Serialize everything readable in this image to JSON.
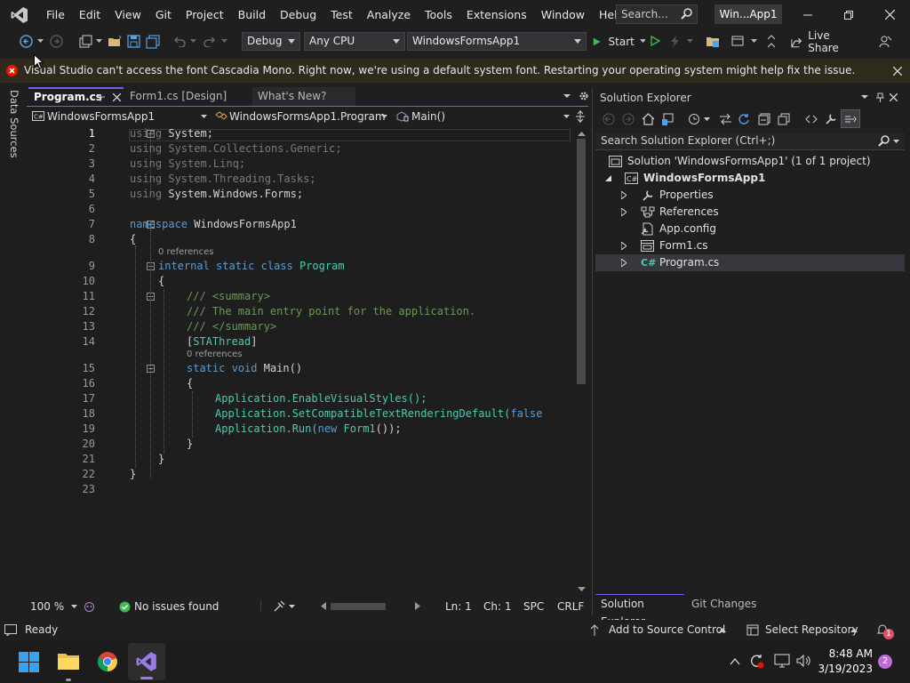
{
  "menu": {
    "items": [
      "File",
      "Edit",
      "View",
      "Git",
      "Project",
      "Build",
      "Debug",
      "Test",
      "Analyze",
      "Tools",
      "Extensions",
      "Window",
      "Help"
    ],
    "search_placeholder": "Search...",
    "window_title": "Win...App1"
  },
  "toolbar": {
    "config": "Debug",
    "platform": "Any CPU",
    "startup_project": "WindowsFormsApp1",
    "start_label": "Start",
    "live_share": "Live Share"
  },
  "infobar": {
    "message": "Visual Studio can't access the font Cascadia Mono. Right now, we're using a default system font. Restarting your operating system might help fix the issue."
  },
  "sidebar": {
    "label": "Data Sources"
  },
  "tabs": [
    {
      "label": "Program.cs",
      "active": true
    },
    {
      "label": "Form1.cs [Design]",
      "active": false
    },
    {
      "label": "What's New?",
      "active": false
    }
  ],
  "navbar": {
    "project": "WindowsFormsApp1",
    "class": "WindowsFormsApp1.Program",
    "member": "Main()"
  },
  "code": {
    "line_numbers": [
      "1",
      "2",
      "3",
      "4",
      "5",
      "6",
      "7",
      "8",
      "9",
      "10",
      "11",
      "12",
      "13",
      "14",
      "15",
      "16",
      "17",
      "18",
      "19",
      "20",
      "21",
      "22",
      "23"
    ],
    "using1": "System;",
    "using2": "System.Collections.Generic;",
    "using3": "System.Linq;",
    "using4": "System.Threading.Tasks;",
    "using5": "System.Windows.Forms;",
    "ns_name": "WindowsFormsApp1",
    "class_name": "Program",
    "ref_label": "0 references",
    "comment1": "/// <summary>",
    "comment2": "/// The main entry point for the application.",
    "comment3": "/// </summary>",
    "attribute": "STAThread",
    "method": "Main",
    "stmt1": "Application.EnableVisualStyles();",
    "stmt2_pre": "Application.SetCompatibleTextRenderingDefault(",
    "stmt2_kw": "false",
    "stmt3_pre": "Application.Run(",
    "stmt3_obj": "Form1",
    "stmt3_post": "());"
  },
  "editor_status": {
    "zoom": "100 %",
    "issues": "No issues found",
    "line": "Ln: 1",
    "col": "Ch: 1",
    "spacing": "SPC",
    "eol": "CRLF"
  },
  "solution_explorer": {
    "title": "Solution Explorer",
    "search_placeholder": "Search Solution Explorer (Ctrl+;)",
    "solution": "Solution 'WindowsFormsApp1' (1 of 1 project)",
    "project": "WindowsFormsApp1",
    "items": [
      "Properties",
      "References",
      "App.config",
      "Form1.cs",
      "Program.cs"
    ],
    "bottom_tabs": [
      "Solution Explorer",
      "Git Changes"
    ]
  },
  "statusbar": {
    "ready": "Ready",
    "add_source_control": "Add to Source Control",
    "select_repository": "Select Repository",
    "notifications": "1"
  },
  "taskbar": {
    "time": "8:48 AM",
    "date": "3/19/2023",
    "notification_count": "2"
  },
  "colors": {
    "keyword": "#569cd6",
    "type": "#4ec9b0",
    "comment": "#6a9955",
    "accent": "#7160e8",
    "error": "#e51400"
  }
}
